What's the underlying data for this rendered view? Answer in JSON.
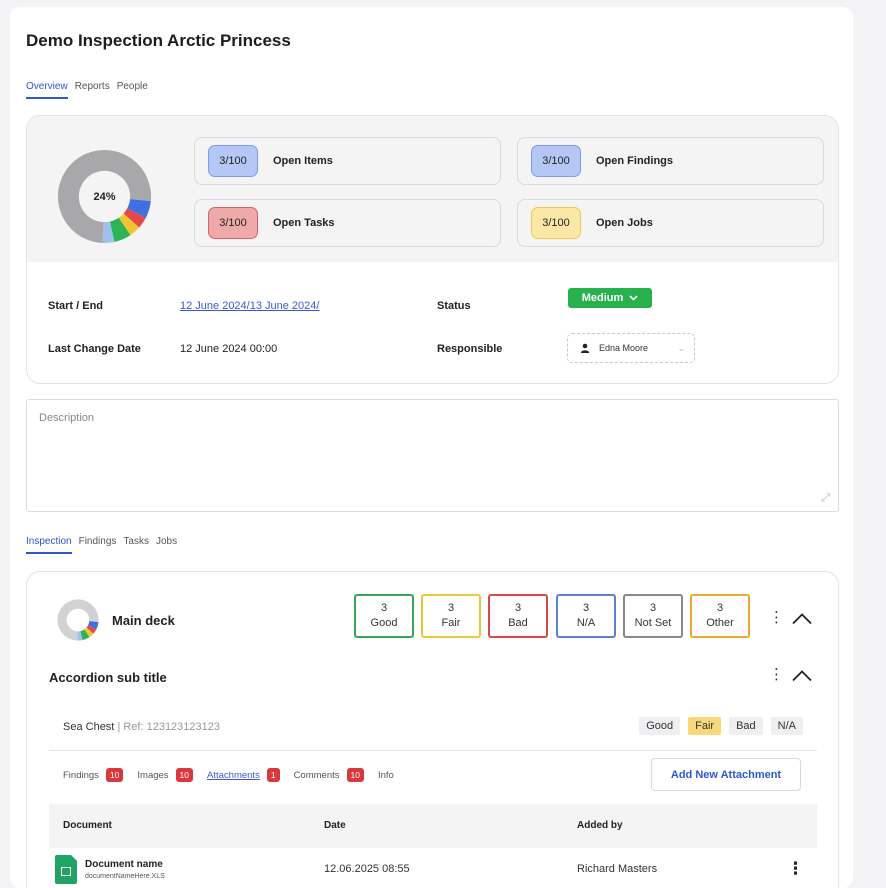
{
  "page": {
    "title": "Demo Inspection Arctic Princess"
  },
  "top_tabs": [
    {
      "label": "Overview",
      "active": true
    },
    {
      "label": "Reports",
      "active": false
    },
    {
      "label": "People",
      "active": false
    }
  ],
  "summary": {
    "progress_label": "24%",
    "progress_segments": [
      {
        "name": "blue",
        "fraction": 0.06,
        "color": "#3f6fe0"
      },
      {
        "name": "red",
        "fraction": 0.04,
        "color": "#e24a4a"
      },
      {
        "name": "yellow",
        "fraction": 0.04,
        "color": "#f2c531"
      },
      {
        "name": "green",
        "fraction": 0.06,
        "color": "#2fb455"
      },
      {
        "name": "lightblue",
        "fraction": 0.04,
        "color": "#9fc1f0"
      },
      {
        "name": "rest",
        "fraction": 0.76,
        "color": "#a8a8aa"
      }
    ],
    "stats": [
      {
        "badge": "3/100",
        "label": "Open Items",
        "tone": "blue"
      },
      {
        "badge": "3/100",
        "label": "Open Findings",
        "tone": "blue"
      },
      {
        "badge": "3/100",
        "label": "Open Tasks",
        "tone": "red"
      },
      {
        "badge": "3/100",
        "label": "Open Jobs",
        "tone": "yellow"
      }
    ],
    "start_end_label": "Start / End",
    "start_end_value": "12 June  2024/13 June  2024/",
    "last_change_label": "Last Change Date",
    "last_change_value": "12 June  2024 00:00",
    "status_label": "Status",
    "status_value": "Medium",
    "responsible_label": "Responsible",
    "responsible_value": "Edna Moore"
  },
  "description": {
    "placeholder": "Description"
  },
  "bottom_tabs": [
    {
      "label": "Inspection",
      "active": true
    },
    {
      "label": "Findings",
      "active": false
    },
    {
      "label": "Tasks",
      "active": false
    },
    {
      "label": "Jobs",
      "active": false
    }
  ],
  "inspection": {
    "section_title": "Main deck",
    "counts": [
      {
        "count": "3",
        "label": "Good",
        "tone": "green"
      },
      {
        "count": "3",
        "label": "Fair",
        "tone": "yellow"
      },
      {
        "count": "3",
        "label": "Bad",
        "tone": "red"
      },
      {
        "count": "3",
        "label": "N/A",
        "tone": "blue"
      },
      {
        "count": "3",
        "label": "Not Set",
        "tone": "gray"
      },
      {
        "count": "3",
        "label": "Other",
        "tone": "orange"
      }
    ],
    "sub_title": "Accordion sub title",
    "item": {
      "name": "Sea Chest",
      "ref": "Ref: 123123123123",
      "ratings": [
        "Good",
        "Fair",
        "Bad",
        "N/A"
      ],
      "selected_rating": "Fair"
    },
    "subtabs": [
      {
        "label": "Findings",
        "count": "10",
        "active": false
      },
      {
        "label": "Images",
        "count": "10",
        "active": false
      },
      {
        "label": "Attachments",
        "count": "1",
        "active": true
      },
      {
        "label": "Comments",
        "count": "10",
        "active": false
      },
      {
        "label": "Info",
        "count": "",
        "active": false
      }
    ],
    "add_button": "Add New Attachment",
    "table": {
      "headers": [
        "Document",
        "Date",
        "Added by"
      ],
      "rows": [
        {
          "doc_name": "Document name",
          "doc_file": "documentNameHere.XLS",
          "date": "12.06.2025 08:55",
          "added_by": "Richard Masters"
        }
      ]
    }
  }
}
